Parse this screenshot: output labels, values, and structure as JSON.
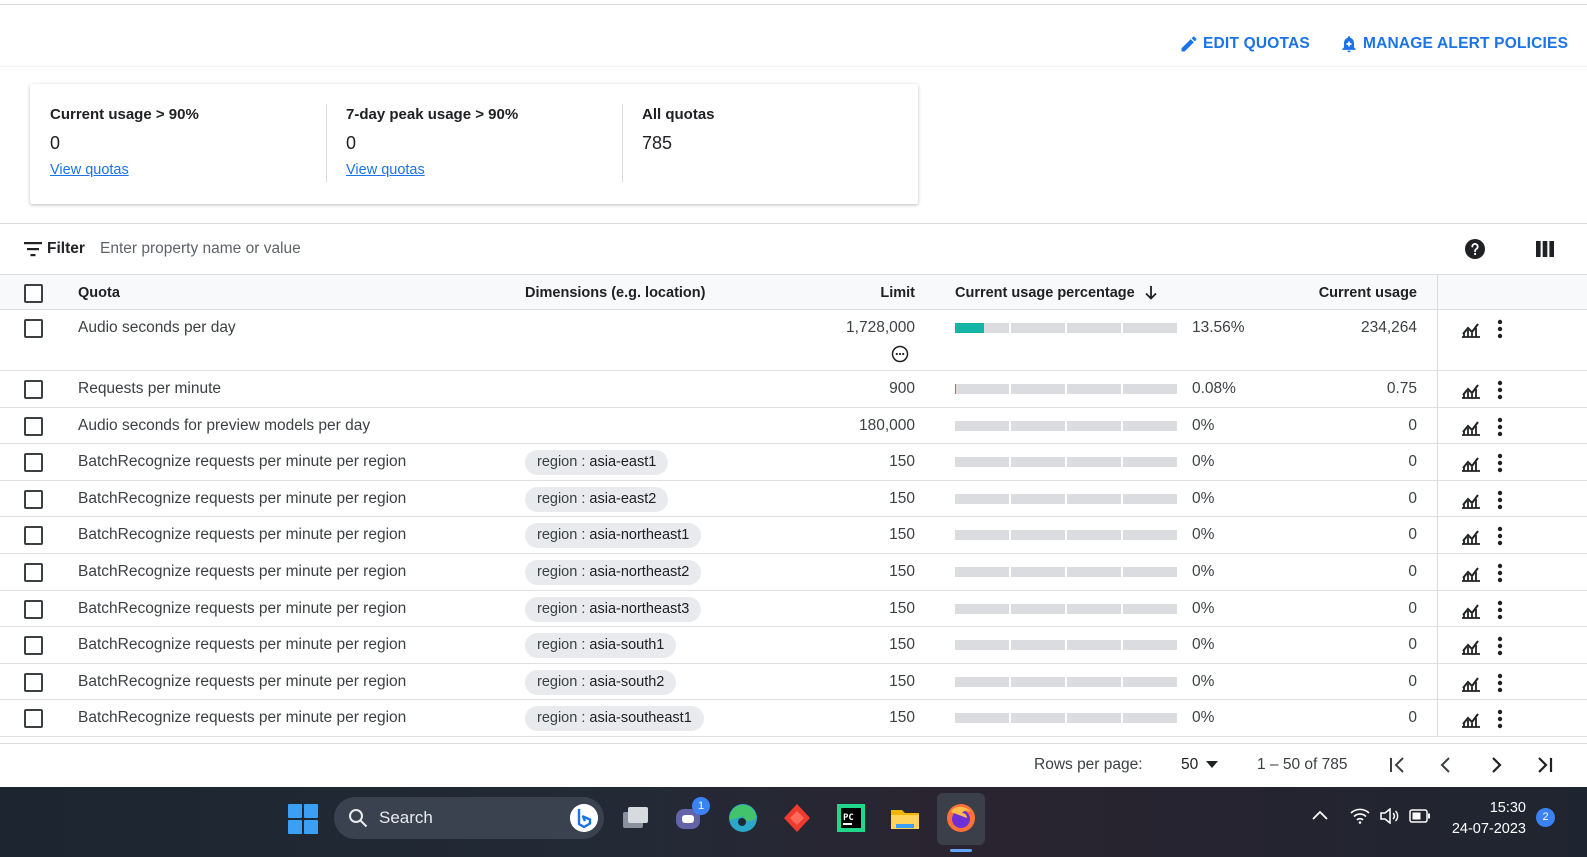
{
  "actions": {
    "edit_quotas": "EDIT QUOTAS",
    "manage_alert_policies": "MANAGE ALERT POLICIES"
  },
  "summary": [
    {
      "label": "Current usage > 90%",
      "value": "0",
      "link": "View quotas"
    },
    {
      "label": "7-day peak usage > 90%",
      "value": "0",
      "link": "View quotas"
    },
    {
      "label": "All quotas",
      "value": "785"
    }
  ],
  "filter": {
    "label": "Filter",
    "placeholder": "Enter property name or value"
  },
  "columns": {
    "quota": "Quota",
    "dimensions": "Dimensions (e.g. location)",
    "limit": "Limit",
    "usage_pct": "Current usage percentage",
    "usage": "Current usage"
  },
  "rows": [
    {
      "quota": "Audio seconds per day",
      "limit": "1,728,000",
      "pct": "13.56%",
      "pct_value": 13.56,
      "usage": "234,264"
    },
    {
      "quota": "Requests per minute",
      "limit": "900",
      "pct": "0.08%",
      "pct_value": 0.08,
      "usage": "0.75"
    },
    {
      "quota": "Audio seconds for preview models per day",
      "limit": "180,000",
      "pct": "0%",
      "pct_value": 0,
      "usage": "0"
    },
    {
      "quota": "BatchRecognize requests per minute per region",
      "dim_key": "region",
      "dim_sep": " : ",
      "dim_value": "asia-east1",
      "limit": "150",
      "pct": "0%",
      "pct_value": 0,
      "usage": "0"
    },
    {
      "quota": "BatchRecognize requests per minute per region",
      "dim_key": "region",
      "dim_sep": " : ",
      "dim_value": "asia-east2",
      "limit": "150",
      "pct": "0%",
      "pct_value": 0,
      "usage": "0"
    },
    {
      "quota": "BatchRecognize requests per minute per region",
      "dim_key": "region",
      "dim_sep": " : ",
      "dim_value": "asia-northeast1",
      "limit": "150",
      "pct": "0%",
      "pct_value": 0,
      "usage": "0"
    },
    {
      "quota": "BatchRecognize requests per minute per region",
      "dim_key": "region",
      "dim_sep": " : ",
      "dim_value": "asia-northeast2",
      "limit": "150",
      "pct": "0%",
      "pct_value": 0,
      "usage": "0"
    },
    {
      "quota": "BatchRecognize requests per minute per region",
      "dim_key": "region",
      "dim_sep": " : ",
      "dim_value": "asia-northeast3",
      "limit": "150",
      "pct": "0%",
      "pct_value": 0,
      "usage": "0"
    },
    {
      "quota": "BatchRecognize requests per minute per region",
      "dim_key": "region",
      "dim_sep": " : ",
      "dim_value": "asia-south1",
      "limit": "150",
      "pct": "0%",
      "pct_value": 0,
      "usage": "0"
    },
    {
      "quota": "BatchRecognize requests per minute per region",
      "dim_key": "region",
      "dim_sep": " : ",
      "dim_value": "asia-south2",
      "limit": "150",
      "pct": "0%",
      "pct_value": 0,
      "usage": "0"
    },
    {
      "quota": "BatchRecognize requests per minute per region",
      "dim_key": "region",
      "dim_sep": " : ",
      "dim_value": "asia-southeast1",
      "limit": "150",
      "pct": "0%",
      "pct_value": 0,
      "usage": "0"
    }
  ],
  "pagination": {
    "rows_per_page_label": "Rows per page:",
    "rows_per_page": "50",
    "range": "1 – 50 of 785"
  },
  "taskbar": {
    "search": "Search",
    "teams_badge": "1",
    "time": "15:30",
    "date": "24-07-2023",
    "notifications": "2"
  },
  "colors": {
    "accent": "#1a73e8",
    "progress_fill": "#12b5a5",
    "progress_track": "#dadce0"
  }
}
